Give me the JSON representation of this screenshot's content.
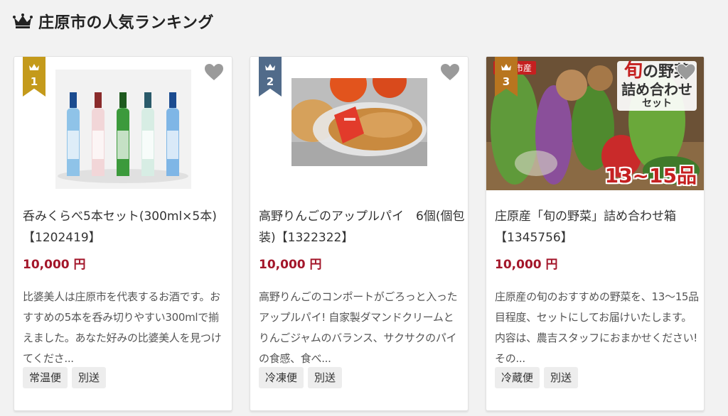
{
  "section": {
    "title": "庄原市の人気ランキング"
  },
  "products": [
    {
      "rank": "1",
      "title": "呑みくらべ5本セット(300ml×5本)【1202419】",
      "price": "10,000 円",
      "description": "比婆美人は庄原市を代表するお酒です。おすすめの5本を呑み切りやすい300mlで揃えました。あなた好みの比婆美人を見つけてくださ...",
      "tags": [
        "常温便",
        "別送"
      ]
    },
    {
      "rank": "2",
      "title": "高野りんごのアップルパイ　6個(個包装)【1322322】",
      "price": "10,000 円",
      "description": "高野りんごのコンポートがごろっと入ったアップルパイ! 自家製ダマンドクリームとりんごジャムのバランス、サクサクのパイの食感、食べ...",
      "tags": [
        "冷凍便",
        "別送"
      ]
    },
    {
      "rank": "3",
      "title": "庄原産「旬の野菜」詰め合わせ箱【1345756】",
      "price": "10,000 円",
      "description": "庄原産の旬のおすすめの野菜を、13〜15品目程度、セットにしてお届けいたします。内容は、農吉スタッフにおまかせください! その...",
      "tags": [
        "冷蔵便",
        "別送"
      ],
      "image_text": {
        "origin": "庄原市産",
        "line1_a": "旬",
        "line1_b": "の野菜",
        "line2": "詰め合わせ",
        "line3": "セット",
        "count": "13~15品"
      }
    }
  ],
  "icons": {
    "header": "crown-icon",
    "badge": "crown-icon",
    "favorite": "heart-icon"
  },
  "colors": {
    "rank1": "#c49a1b",
    "rank2": "#516b8a",
    "rank3": "#b8751f",
    "price": "#a3162a"
  }
}
